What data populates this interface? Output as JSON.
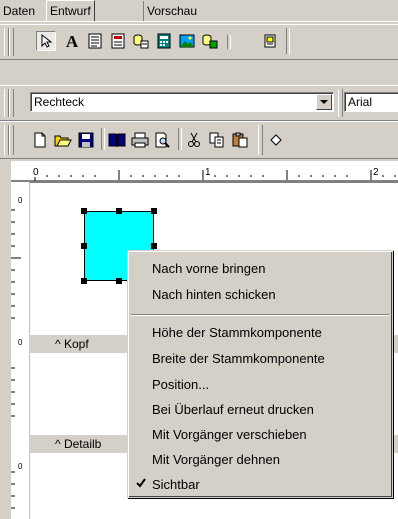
{
  "tabs": [
    "Daten",
    "Entwurf",
    "Vorschau"
  ],
  "object_type_combo": {
    "value": "Rechteck"
  },
  "font_combo": {
    "value": "Arial"
  },
  "ruler": {
    "h_labels": [
      "0",
      "1",
      "2"
    ],
    "v_labels": [
      "0",
      "0",
      "0"
    ]
  },
  "bands": {
    "header": "^  Kopf",
    "detail": "^  Detailb"
  },
  "context_menu": {
    "items": [
      "Nach vorne bringen",
      "Nach hinten schicken",
      "Höhe der Stammkomponente",
      "Breite der Stammkomponente",
      "Position...",
      "Bei Überlauf erneut drucken",
      "Mit Vorgänger verschieben",
      "Mit Vorgänger dehnen",
      "Sichtbar"
    ],
    "checked_item": "Sichtbar"
  },
  "colors": {
    "shape_fill": "#00ffff",
    "chrome": "#d4d0c8"
  }
}
